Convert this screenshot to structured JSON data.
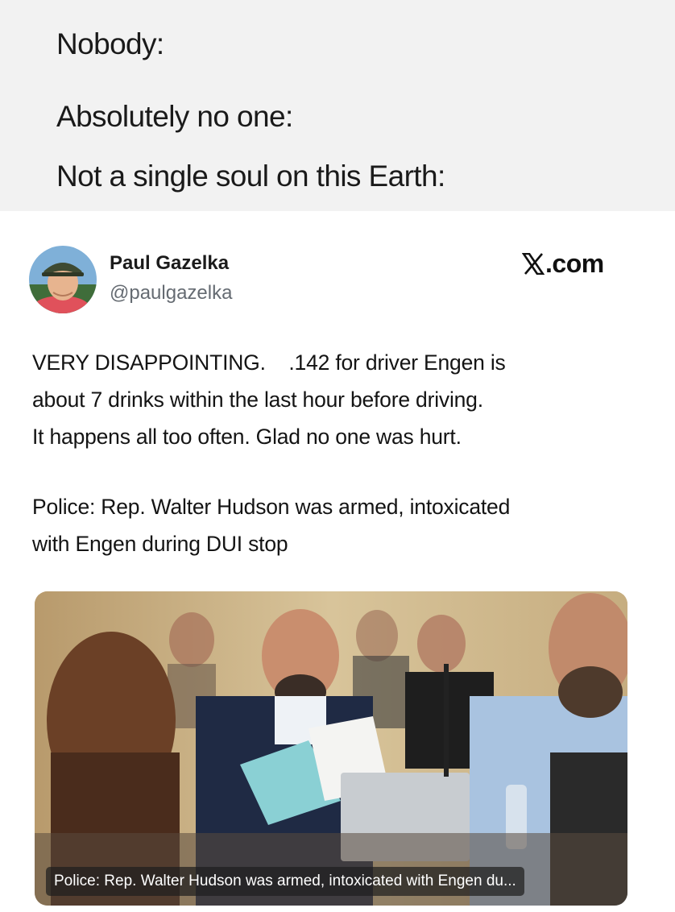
{
  "meme": {
    "lines": [
      "Nobody:",
      "Absolutely no one:",
      "Not a single soul on this Earth:"
    ]
  },
  "post": {
    "author_name": "Paul Gazelka",
    "author_handle": "@paulgazelka",
    "source": ".com",
    "source_icon": "x-logo-icon",
    "text_lines": [
      "VERY DISAPPOINTING.    .142 for driver Engen is",
      "about 7 drinks within the last hour before driving.",
      "It happens all too often. Glad no one was hurt."
    ],
    "link_title_lines": [
      "Police: Rep. Walter Hudson was armed, intoxicated",
      "with Engen during DUI stop"
    ],
    "media_caption": "Police: Rep. Walter Hudson was armed, intoxicated with Engen du..."
  },
  "colors": {
    "page_bg": "#f2f2f2",
    "card_bg": "#ffffff",
    "handle_gray": "#656b72"
  }
}
